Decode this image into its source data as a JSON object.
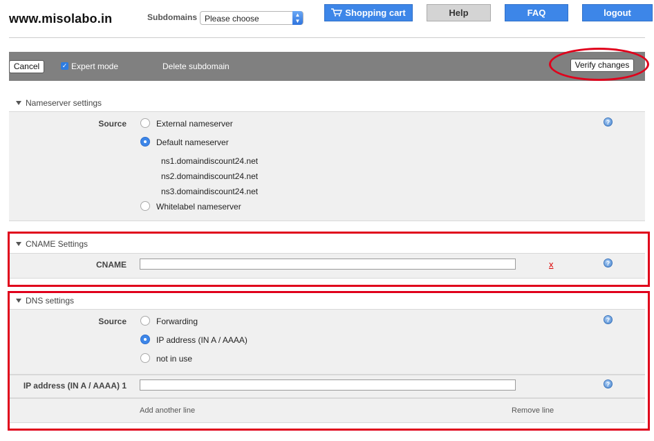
{
  "header": {
    "site_title": "www.misolabo.in",
    "subdomains_label": "Subdomains",
    "subdomains_select_value": "Please choose",
    "buttons": {
      "cart": "Shopping cart",
      "help": "Help",
      "faq": "FAQ",
      "logout": "logout"
    }
  },
  "toolbar": {
    "cancel": "Cancel",
    "expert_mode": "Expert mode",
    "delete_subdomain": "Delete subdomain",
    "verify_changes": "Verify changes"
  },
  "nameserver": {
    "title": "Nameserver settings",
    "source_label": "Source",
    "options": [
      "External nameserver",
      "Default nameserver",
      "Whitelabel nameserver"
    ],
    "selected": "Default nameserver",
    "servers": [
      "ns1.domaindiscount24.net",
      "ns2.domaindiscount24.net",
      "ns3.domaindiscount24.net"
    ]
  },
  "cname": {
    "title": "CNAME Settings",
    "label": "CNAME",
    "value": "",
    "delete": "x"
  },
  "dns": {
    "title": "DNS settings",
    "source_label": "Source",
    "options": [
      "Forwarding",
      "IP address (IN A / AAAA)",
      "not in use"
    ],
    "selected": "IP address (IN A / AAAA)",
    "ip_label": "IP address (IN A / AAAA) 1",
    "ip_value": "",
    "add_line": "Add another line",
    "remove_line": "Remove line"
  },
  "colors": {
    "accent": "#3d86e8",
    "toolbar": "#808080",
    "highlight": "#e0001b"
  }
}
